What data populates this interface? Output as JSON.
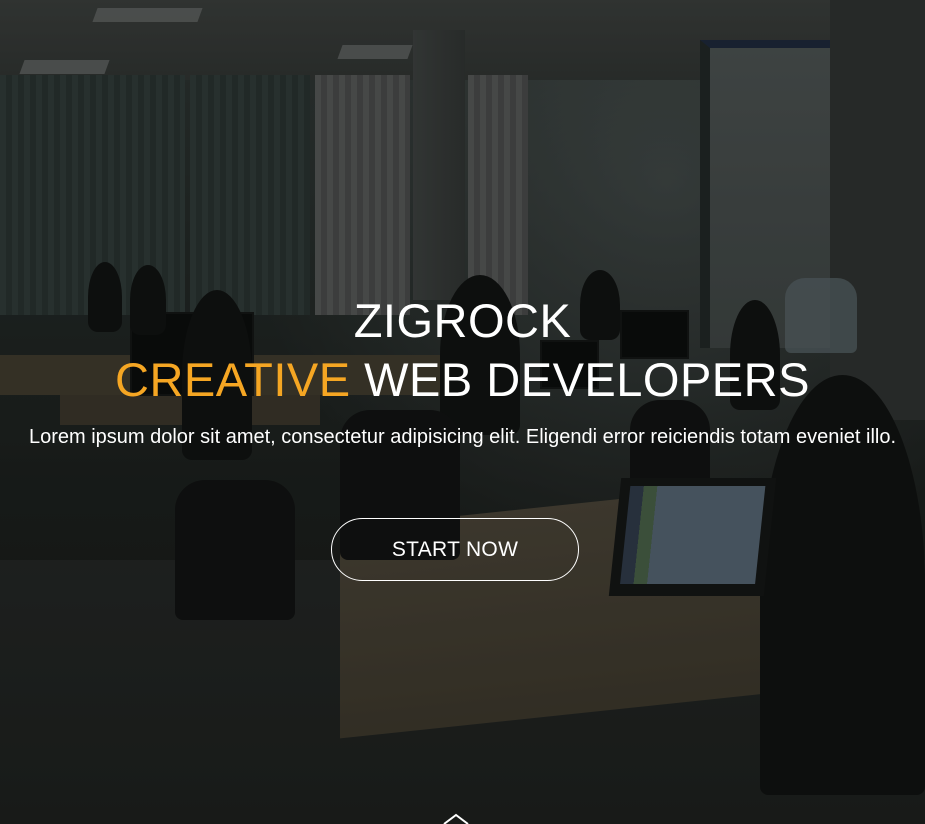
{
  "hero": {
    "brand": "ZIGROCK",
    "tagline_accent": "CREATIVE",
    "tagline_rest": "WEB DEVELOPERS",
    "description": "Lorem ipsum dolor sit amet, consectetur adipisicing elit. Eligendi error reiciendis totam eveniet illo.",
    "cta_label": "START NOW",
    "scroll_icon": "chevron-down-icon"
  },
  "colors": {
    "accent": "#f5a623",
    "text": "#ffffff",
    "overlay": "rgba(0,0,0,0.35)"
  }
}
